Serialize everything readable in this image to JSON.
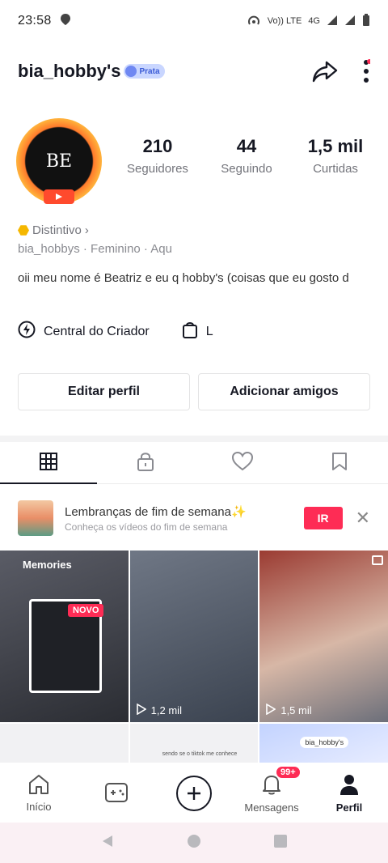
{
  "status_bar": {
    "time": "23:58",
    "indicators": [
      "hotspot-icon",
      "volte-icon",
      "4g-signal-icon",
      "signal-icon",
      "battery-icon"
    ],
    "volte_text": "Vo)) LTE",
    "network": "4G"
  },
  "header": {
    "username": "bia_hobby's",
    "badge": "Prata",
    "icons": [
      "share-icon",
      "more-icon"
    ]
  },
  "profile": {
    "avatar_text": "BE",
    "stats": [
      {
        "value": "210",
        "label": "Seguidores"
      },
      {
        "value": "44",
        "label": "Seguindo"
      },
      {
        "value": "1,5 mil",
        "label": "Curtidas"
      }
    ],
    "distintivo": "Distintivo",
    "meta": "bia_hobbys · Feminino · Aqu",
    "bio": "oii meu nome é Beatriz e eu q hobby's (coisas que eu gosto d"
  },
  "creator": {
    "central_label": "Central do Criador",
    "shop_label": "L"
  },
  "actions": {
    "edit": "Editar perfil",
    "add_friends": "Adicionar amigos"
  },
  "tabs": [
    "videos-grid-icon",
    "lock-icon",
    "heart-icon",
    "bookmark-icon"
  ],
  "reminder": {
    "title": "Lembranças de fim de semana✨",
    "subtitle": "Conheça os vídeos do fim de semana",
    "cta": "IR",
    "close": "✕"
  },
  "grid": {
    "cell1_label": "Memories",
    "new_badge": "NOVO",
    "cell2_views": "1,2 mil",
    "cell3_views": "1,5 mil",
    "row2_user": "bia_hobby's",
    "row2_caption": "sendo se o tiktok me conhece"
  },
  "bottom_nav": [
    {
      "label": "Início",
      "icon": "home-icon"
    },
    {
      "label": "",
      "icon": "games-icon"
    },
    {
      "label": "",
      "icon": "plus-icon"
    },
    {
      "label": "Mensagens",
      "icon": "bell-icon",
      "badge": "99+"
    },
    {
      "label": "Perfil",
      "icon": "profile-icon"
    }
  ],
  "colors": {
    "accent": "#fe2c55",
    "text": "#161823",
    "muted": "#73747b"
  }
}
